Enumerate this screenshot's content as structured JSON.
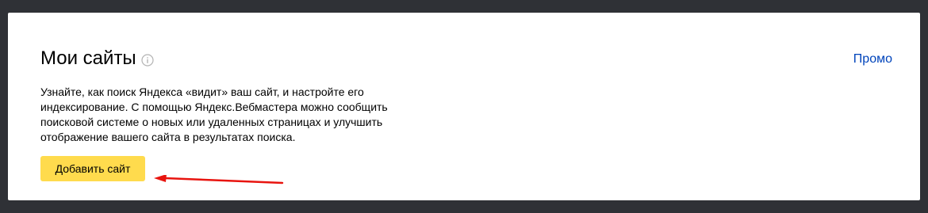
{
  "card": {
    "title": "Мои сайты",
    "info_icon": "info-circle-icon",
    "promo_label": "Промо",
    "description": "Узнайте, как поиск Яндекса «видит» ваш сайт, и настройте его индексирование. С помощью Яндекс.Вебмастера можно сообщить поисковой системе о новых или удаленных страницах и улучшить отображение вашего сайта в результатах поиска.",
    "add_button_label": "Добавить сайт"
  },
  "annotation": {
    "arrow_icon": "red-arrow-left-icon",
    "arrow_color": "#e8140f"
  },
  "colors": {
    "background": "#2f3136",
    "card": "#ffffff",
    "button": "#ffdb4d",
    "link": "#0044bb"
  }
}
